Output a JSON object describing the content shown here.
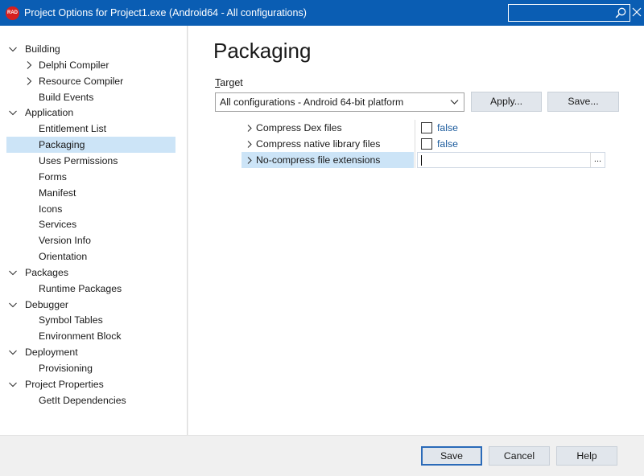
{
  "window": {
    "logo_text": "RAD",
    "title": "Project Options for Project1.exe  (Android64 - All configurations)",
    "accent_color": "#0a5db3",
    "search_value": ""
  },
  "tree": {
    "items": [
      {
        "label": "Building",
        "level": 0,
        "expanded": true
      },
      {
        "label": "Delphi Compiler",
        "level": 1,
        "expanded": false,
        "has_children": true
      },
      {
        "label": "Resource Compiler",
        "level": 1,
        "expanded": false,
        "has_children": true
      },
      {
        "label": "Build Events",
        "level": 1
      },
      {
        "label": "Application",
        "level": 0,
        "expanded": true
      },
      {
        "label": "Entitlement List",
        "level": 1
      },
      {
        "label": "Packaging",
        "level": 1,
        "selected": true
      },
      {
        "label": "Uses Permissions",
        "level": 1
      },
      {
        "label": "Forms",
        "level": 1
      },
      {
        "label": "Manifest",
        "level": 1
      },
      {
        "label": "Icons",
        "level": 1
      },
      {
        "label": "Services",
        "level": 1
      },
      {
        "label": "Version Info",
        "level": 1
      },
      {
        "label": "Orientation",
        "level": 1
      },
      {
        "label": "Packages",
        "level": 0,
        "expanded": true
      },
      {
        "label": "Runtime Packages",
        "level": 1
      },
      {
        "label": "Debugger",
        "level": 0,
        "expanded": true
      },
      {
        "label": "Symbol Tables",
        "level": 1
      },
      {
        "label": "Environment Block",
        "level": 1
      },
      {
        "label": "Deployment",
        "level": 0,
        "expanded": true
      },
      {
        "label": "Provisioning",
        "level": 1
      },
      {
        "label": "Project Properties",
        "level": 0,
        "expanded": true
      },
      {
        "label": "GetIt Dependencies",
        "level": 1
      }
    ]
  },
  "main": {
    "page_title": "Packaging",
    "target_label_accel": "T",
    "target_label_rest": "arget",
    "target_value": "All configurations - Android 64-bit platform",
    "apply_label": "Apply...",
    "save_label": "Save...",
    "properties": [
      {
        "name": "Compress Dex files",
        "type": "bool",
        "checked": false,
        "value": "false"
      },
      {
        "name": "Compress native library files",
        "type": "bool",
        "checked": false,
        "value": "false"
      },
      {
        "name": "No-compress file extensions",
        "type": "text",
        "value": "",
        "selected": true,
        "ellipsis": "..."
      }
    ]
  },
  "footer": {
    "save_label": "Save",
    "cancel_label": "Cancel",
    "help_label": "Help"
  }
}
